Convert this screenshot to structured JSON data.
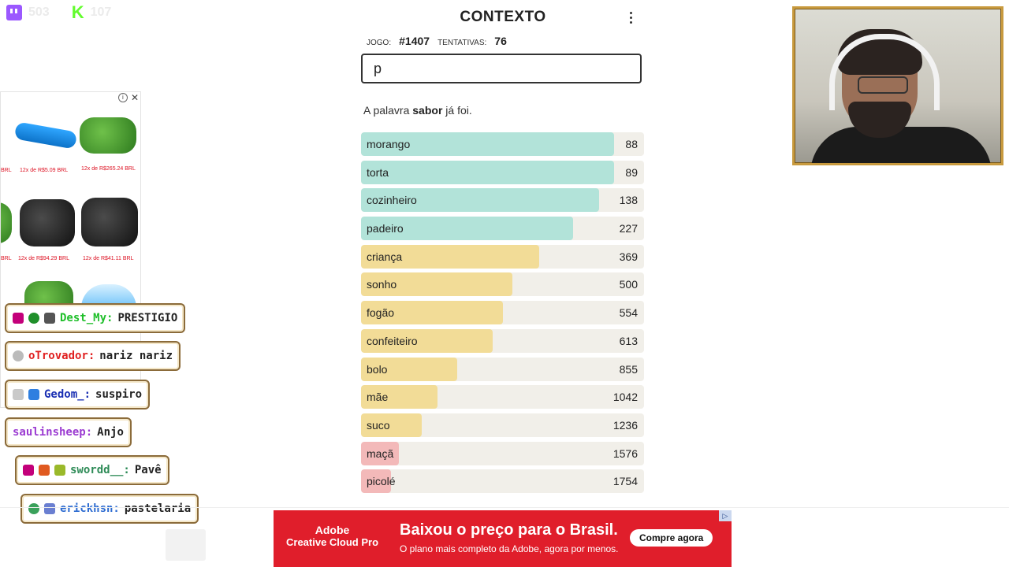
{
  "overlay": {
    "twitch_count": "503",
    "kick_count": "107",
    "twitch_color": "#9146ff",
    "kick_color": "#53fc18"
  },
  "game": {
    "title": "CONTEXTO",
    "game_label": "JOGO:",
    "game_number": "#1407",
    "attempts_label": "TENTATIVAS:",
    "attempts_value": "76",
    "input_value": "p",
    "message_prefix": "A palavra ",
    "message_word": "sabor",
    "message_suffix": " já foi.",
    "guesses": [
      {
        "word": "morango",
        "rank": "88",
        "fill": 0.895,
        "color": "#b2e3d9"
      },
      {
        "word": "torta",
        "rank": "89",
        "fill": 0.895,
        "color": "#b2e3d9"
      },
      {
        "word": "cozinheiro",
        "rank": "138",
        "fill": 0.84,
        "color": "#b2e3d9"
      },
      {
        "word": "padeiro",
        "rank": "227",
        "fill": 0.75,
        "color": "#b2e3d9"
      },
      {
        "word": "criança",
        "rank": "369",
        "fill": 0.63,
        "color": "#f2dc97"
      },
      {
        "word": "sonho",
        "rank": "500",
        "fill": 0.535,
        "color": "#f2dc97"
      },
      {
        "word": "fogão",
        "rank": "554",
        "fill": 0.5,
        "color": "#f2dc97"
      },
      {
        "word": "confeiteiro",
        "rank": "613",
        "fill": 0.465,
        "color": "#f2dc97"
      },
      {
        "word": "bolo",
        "rank": "855",
        "fill": 0.34,
        "color": "#f2dc97"
      },
      {
        "word": "mãe",
        "rank": "1042",
        "fill": 0.27,
        "color": "#f2dc97"
      },
      {
        "word": "suco",
        "rank": "1236",
        "fill": 0.215,
        "color": "#f2dc97"
      },
      {
        "word": "maçã",
        "rank": "1576",
        "fill": 0.135,
        "color": "#f3b9b9"
      },
      {
        "word": "picolé",
        "rank": "1754",
        "fill": 0.105,
        "color": "#f3b9b9"
      }
    ]
  },
  "left_ad": {
    "prices": [
      "BRL",
      "12x de R$5.09 BRL",
      "12x de R$265.24 BRL",
      "BRL",
      "12x de R$94.29 BRL",
      "12x de R$41.11 BRL"
    ]
  },
  "chat": [
    {
      "user": "Dest_My:",
      "text": "PRESTIGIO",
      "color": "#1fbf2a"
    },
    {
      "user": "oTrovador:",
      "text": "nariz nariz",
      "color": "#e02020"
    },
    {
      "user": "Gedom_:",
      "text": "suspiro",
      "color": "#1a2fb3"
    },
    {
      "user": "saulinsheep:",
      "text": "Anjo",
      "color": "#9b3bd1"
    },
    {
      "user": "swordd__:",
      "text": "Pavê",
      "color": "#2e8b57"
    },
    {
      "user": "erickhsn:",
      "text": "pastelaria",
      "color": "#2c6bd1"
    }
  ],
  "banner": {
    "brand_1": "Adobe",
    "brand_2": "Creative Cloud Pro",
    "headline": "Baixou o preço para o Brasil.",
    "subline": "O plano mais completo da Adobe, agora por menos.",
    "cta": "Compre agora",
    "adchoice": "▷"
  }
}
